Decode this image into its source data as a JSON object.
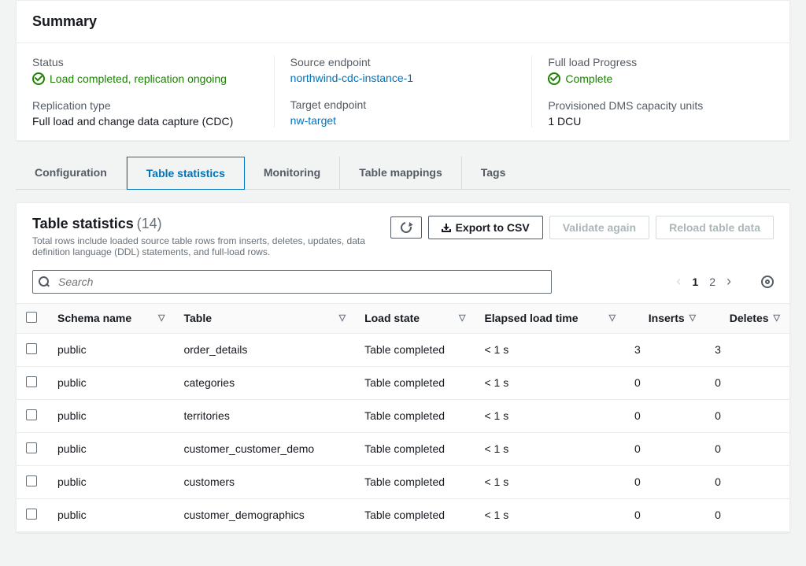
{
  "summary": {
    "heading": "Summary",
    "status_label": "Status",
    "status_value": "Load completed, replication ongoing",
    "replication_type_label": "Replication type",
    "replication_type_value": "Full load and change data capture (CDC)",
    "source_endpoint_label": "Source endpoint",
    "source_endpoint_value": "northwind-cdc-instance-1",
    "target_endpoint_label": "Target endpoint",
    "target_endpoint_value": "nw-target",
    "full_load_progress_label": "Full load Progress",
    "full_load_progress_value": "Complete",
    "capacity_label": "Provisioned DMS capacity units",
    "capacity_value": "1 DCU"
  },
  "tabs": {
    "configuration": "Configuration",
    "table_statistics": "Table statistics",
    "monitoring": "Monitoring",
    "table_mappings": "Table mappings",
    "tags": "Tags"
  },
  "stats": {
    "title": "Table statistics",
    "count": "(14)",
    "description": "Total rows include loaded source table rows from inserts, deletes, updates, data definition language (DDL) statements, and full-load rows.",
    "export_label": "Export to CSV",
    "validate_label": "Validate again",
    "reload_label": "Reload table data",
    "search_placeholder": "Search"
  },
  "pager": {
    "page1": "1",
    "page2": "2"
  },
  "columns": {
    "schema": "Schema name",
    "table": "Table",
    "load_state": "Load state",
    "elapsed": "Elapsed load time",
    "inserts": "Inserts",
    "deletes": "Deletes"
  },
  "rows": [
    {
      "schema": "public",
      "table": "order_details",
      "state": "Table completed",
      "elapsed": "< 1 s",
      "inserts": "3",
      "deletes": "3"
    },
    {
      "schema": "public",
      "table": "categories",
      "state": "Table completed",
      "elapsed": "< 1 s",
      "inserts": "0",
      "deletes": "0"
    },
    {
      "schema": "public",
      "table": "territories",
      "state": "Table completed",
      "elapsed": "< 1 s",
      "inserts": "0",
      "deletes": "0"
    },
    {
      "schema": "public",
      "table": "customer_customer_demo",
      "state": "Table completed",
      "elapsed": "< 1 s",
      "inserts": "0",
      "deletes": "0"
    },
    {
      "schema": "public",
      "table": "customers",
      "state": "Table completed",
      "elapsed": "< 1 s",
      "inserts": "0",
      "deletes": "0"
    },
    {
      "schema": "public",
      "table": "customer_demographics",
      "state": "Table completed",
      "elapsed": "< 1 s",
      "inserts": "0",
      "deletes": "0"
    }
  ]
}
